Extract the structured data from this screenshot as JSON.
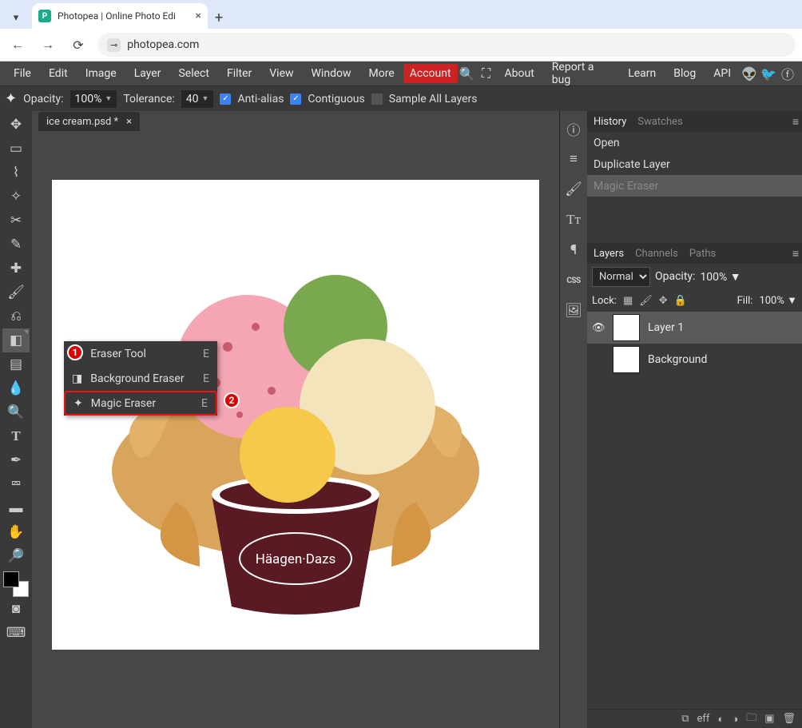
{
  "browser": {
    "tab_title": "Photopea | Online Photo Edi",
    "url": "photopea.com"
  },
  "menu": {
    "items": [
      "File",
      "Edit",
      "Image",
      "Layer",
      "Select",
      "Filter",
      "View",
      "Window",
      "More"
    ],
    "account": "Account",
    "right": [
      "About",
      "Report a bug",
      "Learn",
      "Blog",
      "API"
    ]
  },
  "options": {
    "opacity_label": "Opacity:",
    "opacity_value": "100%",
    "tolerance_label": "Tolerance:",
    "tolerance_value": "40",
    "anti_alias": "Anti-alias",
    "contiguous": "Contiguous",
    "sample_all": "Sample All Layers"
  },
  "doc_tab": {
    "name": "ice cream.psd *"
  },
  "flyout": {
    "items": [
      {
        "label": "Eraser Tool",
        "key": "E"
      },
      {
        "label": "Background Eraser",
        "key": "E"
      },
      {
        "label": "Magic Eraser",
        "key": "E"
      }
    ]
  },
  "history": {
    "tab1": "History",
    "tab2": "Swatches",
    "items": [
      "Open",
      "Duplicate Layer",
      "Magic Eraser"
    ]
  },
  "layers_panel": {
    "tab1": "Layers",
    "tab2": "Channels",
    "tab3": "Paths",
    "blend": "Normal",
    "opacity_label": "Opacity:",
    "opacity_value": "100%",
    "lock_label": "Lock:",
    "fill_label": "Fill:",
    "fill_value": "100%",
    "layers": [
      {
        "name": "Layer 1",
        "visible": true,
        "selected": true
      },
      {
        "name": "Background",
        "visible": false,
        "selected": false
      }
    ]
  },
  "bottom_eff": "eff"
}
